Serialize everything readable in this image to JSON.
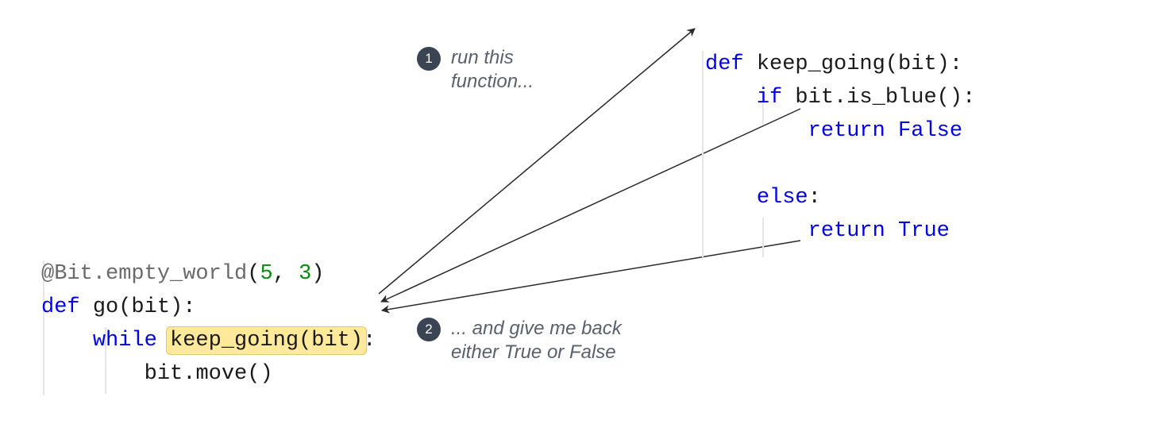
{
  "callouts": {
    "one": {
      "num": "1",
      "text_a": "run this",
      "text_b": "function..."
    },
    "two": {
      "num": "2",
      "text_a": "... and give me back",
      "text_b": "either True or False"
    }
  },
  "left_code": {
    "l1": {
      "deco_at": "@",
      "deco_name": "Bit.empty_world",
      "lp": "(",
      "n1": "5",
      "comma": ", ",
      "n2": "3",
      "rp": ")"
    },
    "l2": {
      "def": "def ",
      "fn": "go",
      "lp": "(",
      "arg": "bit",
      "rp": ")",
      "colon": ":"
    },
    "l3": {
      "indent1": "    ",
      "while": "while ",
      "call": "keep_going",
      "lp": "(",
      "arg": "bit",
      "rp": ")",
      "colon": ":"
    },
    "l4": {
      "indent2": "        ",
      "obj": "bit",
      "dot": ".",
      "meth": "move",
      "lp": "(",
      "rp": ")"
    }
  },
  "right_code": {
    "r1": {
      "def": "def ",
      "fn": "keep_going",
      "lp": "(",
      "arg": "bit",
      "rp": ")",
      "colon": ":"
    },
    "r2": {
      "indent1": "    ",
      "if": "if ",
      "obj": "bit",
      "dot": ".",
      "meth": "is_blue",
      "lp": "(",
      "rp": ")",
      "colon": ":"
    },
    "r3": {
      "indent2": "        ",
      "ret": "return ",
      "val": "False"
    },
    "r4": {
      "blank": ""
    },
    "r5": {
      "indent1": "    ",
      "else": "else",
      "colon": ":"
    },
    "r6": {
      "indent2": "        ",
      "ret": "return ",
      "val": "True"
    }
  }
}
